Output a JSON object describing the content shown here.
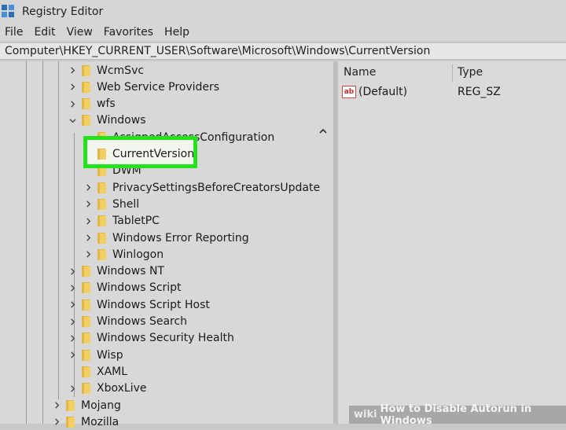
{
  "window": {
    "title": "Registry Editor"
  },
  "menu": [
    "File",
    "Edit",
    "View",
    "Favorites",
    "Help"
  ],
  "address": "Computer\\HKEY_CURRENT_USER\\Software\\Microsoft\\Windows\\CurrentVersion",
  "tree": [
    {
      "label": "WcmSvc",
      "state": "collapsed"
    },
    {
      "label": "Web Service Providers",
      "state": "collapsed"
    },
    {
      "label": "wfs",
      "state": "collapsed"
    },
    {
      "label": "Windows",
      "state": "expanded"
    },
    {
      "label": "AssignedAccessConfiguration",
      "state": "none"
    },
    {
      "label": "CurrentVersion",
      "state": "selected"
    },
    {
      "label": "DWM",
      "state": "none"
    },
    {
      "label": "PrivacySettingsBeforeCreatorsUpdate",
      "state": "collapsed"
    },
    {
      "label": "Shell",
      "state": "collapsed"
    },
    {
      "label": "TabletPC",
      "state": "collapsed"
    },
    {
      "label": "Windows Error Reporting",
      "state": "collapsed"
    },
    {
      "label": "Winlogon",
      "state": "collapsed"
    },
    {
      "label": "Windows NT",
      "state": "collapsed"
    },
    {
      "label": "Windows Script",
      "state": "collapsed"
    },
    {
      "label": "Windows Script Host",
      "state": "collapsed"
    },
    {
      "label": "Windows Search",
      "state": "collapsed"
    },
    {
      "label": "Windows Security Health",
      "state": "collapsed"
    },
    {
      "label": "Wisp",
      "state": "collapsed"
    },
    {
      "label": "XAML",
      "state": "none"
    },
    {
      "label": "XboxLive",
      "state": "collapsed"
    },
    {
      "label": "Mojang",
      "state": "collapsed"
    },
    {
      "label": "Mozilla",
      "state": "collapsed"
    }
  ],
  "values_pane": {
    "columns": [
      "Name",
      "Type"
    ],
    "rows": [
      {
        "name": "(Default)",
        "type": "REG_SZ",
        "icon": "ab-string-icon"
      }
    ]
  },
  "watermark": {
    "brand": "wiki",
    "text": "How to Disable Autorun in Windows"
  },
  "colors": {
    "highlight": "#22e31c",
    "folder": "#f2cf63"
  }
}
